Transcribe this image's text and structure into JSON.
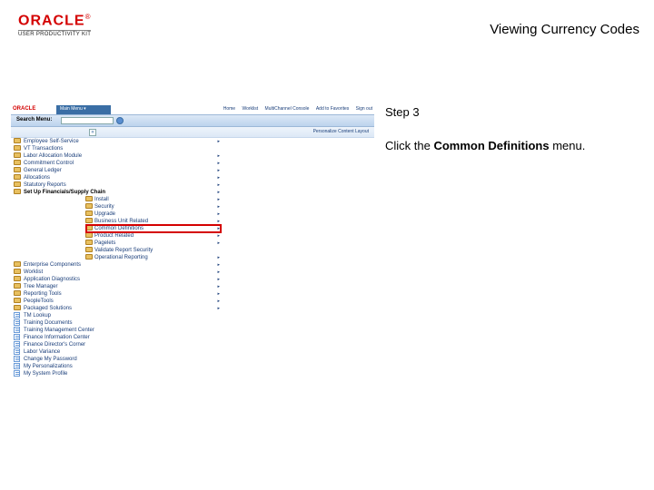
{
  "header": {
    "logo_brand": "ORACLE",
    "logo_reg": "®",
    "logo_sub": "USER PRODUCTIVITY KIT",
    "title": "Viewing Currency Codes"
  },
  "instruction": {
    "step_label": "Step 3",
    "line_prefix": "Click the ",
    "line_bold": "Common Definitions",
    "line_suffix": " menu."
  },
  "app": {
    "brand": "ORACLE",
    "tab_main": "Main Menu",
    "nav": {
      "home": "Home",
      "worklist": "Worklist",
      "mcc": "MultiChannel Console",
      "atf": "Add to Favorites",
      "signout": "Sign out"
    },
    "toolbar": {
      "search_label": "Search Menu:"
    },
    "subbar": {
      "pc": "Personalize Content  Layout"
    },
    "menu_left": [
      {
        "icon": "folder",
        "label": "Employee Self-Service",
        "exp": true
      },
      {
        "icon": "folder",
        "label": "VT Transactions",
        "exp": false
      },
      {
        "icon": "folder",
        "label": "Labor Allocation Module",
        "exp": true
      },
      {
        "icon": "folder",
        "label": "Commitment Control",
        "exp": true
      },
      {
        "icon": "folder",
        "label": "General Ledger",
        "exp": true
      },
      {
        "icon": "folder",
        "label": "Allocations",
        "exp": true
      },
      {
        "icon": "folder",
        "label": "Statutory Reports",
        "exp": true
      },
      {
        "icon": "folder",
        "label": "Set Up Financials/Supply Chain",
        "exp": true,
        "selected": true
      },
      {
        "icon": "folder",
        "label": "Enterprise Components",
        "exp": true
      },
      {
        "icon": "folder",
        "label": "Worklist",
        "exp": true
      },
      {
        "icon": "folder",
        "label": "Application Diagnostics",
        "exp": true
      },
      {
        "icon": "folder",
        "label": "Tree Manager",
        "exp": true
      },
      {
        "icon": "folder",
        "label": "Reporting Tools",
        "exp": true
      },
      {
        "icon": "folder",
        "label": "PeopleTools",
        "exp": true
      },
      {
        "icon": "folder",
        "label": "Packaged Solutions",
        "exp": true
      },
      {
        "icon": "doc",
        "label": "TM Lookup",
        "exp": false
      },
      {
        "icon": "doc",
        "label": "Training Documents",
        "exp": false
      },
      {
        "icon": "doc",
        "label": "Training Management Center",
        "exp": false
      },
      {
        "icon": "doc",
        "label": "Finance Information Center",
        "exp": false
      },
      {
        "icon": "doc",
        "label": "Finance Director's Corner",
        "exp": false
      },
      {
        "icon": "doc",
        "label": "Labor Variance",
        "exp": false
      },
      {
        "icon": "doc",
        "label": "Change My Password",
        "exp": false
      },
      {
        "icon": "doc",
        "label": "My Personalizations",
        "exp": false
      },
      {
        "icon": "doc",
        "label": "My System Profile",
        "exp": false
      }
    ],
    "submenu": [
      {
        "label": "Install",
        "exp": true
      },
      {
        "label": "Security",
        "exp": true
      },
      {
        "label": "Upgrade",
        "exp": true
      },
      {
        "label": "Business Unit Related",
        "exp": true
      },
      {
        "label": "Common Definitions",
        "exp": true,
        "highlight": true
      },
      {
        "label": "Product Related",
        "exp": true
      },
      {
        "label": "Pagelets",
        "exp": true
      },
      {
        "label": "Validate Report Security",
        "exp": false
      },
      {
        "label": "Operational Reporting",
        "exp": true
      }
    ],
    "highlight_label": "Common Definitions"
  }
}
